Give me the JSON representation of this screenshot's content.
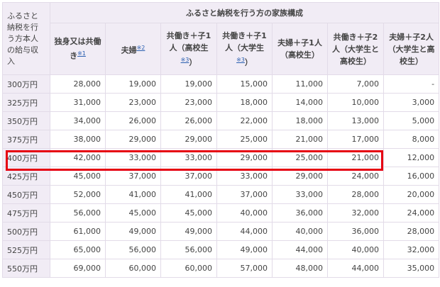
{
  "table": {
    "corner_header": "ふるさと納税を行う方本人の給与収入",
    "group_header": "ふるさと納税を行う方の家族構成",
    "columns": [
      {
        "label": "独身又は共働き",
        "note": "※1"
      },
      {
        "label": "夫婦",
        "note": "※2"
      },
      {
        "label": "共働き＋子1人（高校生",
        "note": "※3",
        "suffix": "）"
      },
      {
        "label": "共働き＋子1人（大学生",
        "note": "※3",
        "suffix": "）"
      },
      {
        "label": "夫婦＋子1人（高校生）",
        "note": "",
        "suffix": ""
      },
      {
        "label": "共働き＋子2人（大学生と高校生）",
        "note": "",
        "suffix": ""
      },
      {
        "label": "夫婦＋子2人（大学生と高校生）",
        "note": "",
        "suffix": ""
      }
    ],
    "rows": [
      {
        "income": "300万円",
        "values": [
          "28,000",
          "19,000",
          "19,000",
          "15,000",
          "11,000",
          "7,000",
          "-"
        ]
      },
      {
        "income": "325万円",
        "values": [
          "31,000",
          "23,000",
          "23,000",
          "18,000",
          "14,000",
          "10,000",
          "3,000"
        ]
      },
      {
        "income": "350万円",
        "values": [
          "34,000",
          "26,000",
          "26,000",
          "22,000",
          "18,000",
          "13,000",
          "5,000"
        ]
      },
      {
        "income": "375万円",
        "values": [
          "38,000",
          "29,000",
          "29,000",
          "25,000",
          "21,000",
          "17,000",
          "8,000"
        ]
      },
      {
        "income": "400万円",
        "values": [
          "42,000",
          "33,000",
          "33,000",
          "29,000",
          "25,000",
          "21,000",
          "12,000"
        ]
      },
      {
        "income": "425万円",
        "values": [
          "45,000",
          "37,000",
          "37,000",
          "33,000",
          "29,000",
          "24,000",
          "16,000"
        ]
      },
      {
        "income": "450万円",
        "values": [
          "52,000",
          "41,000",
          "41,000",
          "37,000",
          "33,000",
          "28,000",
          "20,000"
        ]
      },
      {
        "income": "475万円",
        "values": [
          "56,000",
          "45,000",
          "45,000",
          "40,000",
          "36,000",
          "32,000",
          "24,000"
        ]
      },
      {
        "income": "500万円",
        "values": [
          "61,000",
          "49,000",
          "49,000",
          "44,000",
          "40,000",
          "36,000",
          "28,000"
        ]
      },
      {
        "income": "525万円",
        "values": [
          "65,000",
          "56,000",
          "56,000",
          "49,000",
          "44,000",
          "40,000",
          "32,000"
        ]
      },
      {
        "income": "550万円",
        "values": [
          "69,000",
          "60,000",
          "60,000",
          "57,000",
          "48,000",
          "44,000",
          "35,000"
        ]
      }
    ],
    "highlight_color": "#e60012",
    "header_bg": "#f1ecf5",
    "link_color": "#2a5fb0"
  }
}
